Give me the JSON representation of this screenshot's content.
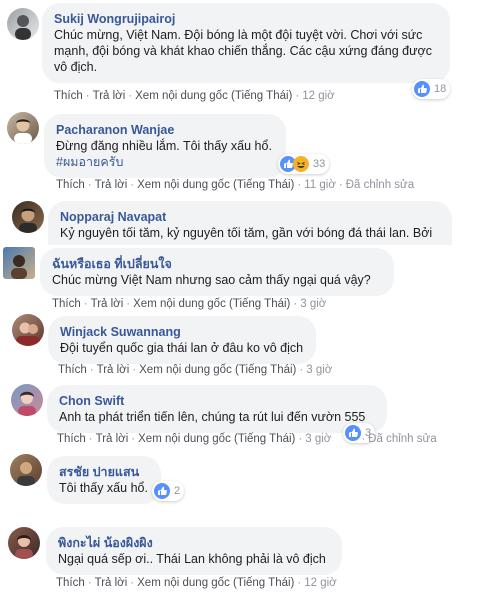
{
  "common": {
    "like": "Thích",
    "reply": "Trả lời",
    "see_original": "Xem nội dung gốc (Tiếng Thái)",
    "edited": "Đã chỉnh sửa",
    "sep": "·"
  },
  "comments": [
    {
      "author": "Sukij Wongrujipairoj",
      "lines": [
        "Chúc mừng, Việt Nam. Đội bóng là một đội tuyệt vời. Chơi với sức",
        "mạnh, đội bóng và khát khao chiến thắng. Các cậu xứng đáng được",
        "vô địch."
      ],
      "time": "12 giờ",
      "reaction_count": "18"
    },
    {
      "author": "Pacharanon Wanjae",
      "lines": [
        "Đừng đăng nhiều lắm. Tôi thấy xấu hổ."
      ],
      "tag": "#ผมอายครับ",
      "time": "11 giờ",
      "reaction_count": "33"
    },
    {
      "author": "Nopparaj Navapat",
      "lines": [
        "Kỷ nguyên tối tăm, kỷ nguyên tối tăm, gần với bóng đá thái lan. Bởi"
      ]
    },
    {
      "author": "ฉันหรือเธอ ที่เปลี่ยนใจ",
      "lines": [
        "Chúc mừng Việt Nam nhưng sao cảm thấy ngại quá vậy?"
      ],
      "time": "3 giờ"
    },
    {
      "author": "Winjack Suwannang",
      "lines": [
        "Đội tuyển quốc gia thái lan ở đâu ko vô địch"
      ],
      "time": "3 giờ"
    },
    {
      "author": "Chon Swift",
      "lines": [
        "Anh ta phát triển tiến lên, chúng ta rút lui đến vườn 555"
      ],
      "time": "3 giờ",
      "reaction_count": "3"
    },
    {
      "author": "สรชัย ปายแสน",
      "lines": [
        "Tôi thấy xấu hổ."
      ],
      "reaction_count": "2"
    },
    {
      "author": "พิงกะไผ่ น้องผิงผิง",
      "lines": [
        "Ngại quá sếp ơi.. Thái Lan không phải là vô địch"
      ],
      "time": "12 giờ"
    }
  ]
}
